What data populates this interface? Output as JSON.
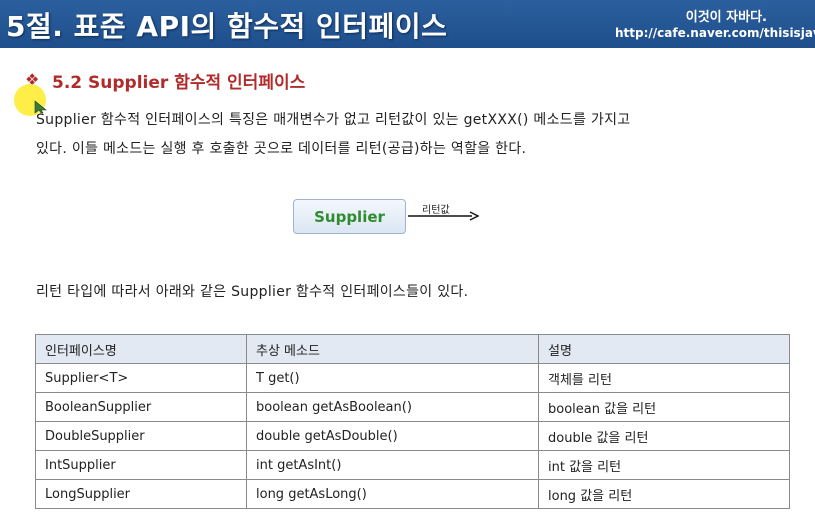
{
  "header": {
    "title": "5절. 표준 API의 함수적 인터페이스",
    "brand": "이것이 자바다.",
    "url": "http://cafe.naver.com/thisisjava"
  },
  "section": {
    "bullet": "❖",
    "heading": "5.2 Supplier 함수적 인터페이스",
    "para1": "Supplier 함수적 인터페이스의 특징은 매개변수가 없고 리턴값이 있는 getXXX() 메소드를 가지고",
    "para2": "있다. 이들 메소드는 실행 후 호출한 곳으로 데이터를 리턴(공급)하는 역할을 한다.",
    "para3": "리턴 타입에 따라서 아래와 같은 Supplier 함수적 인터페이스들이 있다."
  },
  "diagram": {
    "box_label": "Supplier",
    "arrow_label": "리턴값"
  },
  "table": {
    "headers": [
      "인터페이스명",
      "추상 메소드",
      "설명"
    ],
    "rows": [
      [
        "Supplier<T>",
        "T get()",
        "객체를 리턴"
      ],
      [
        "BooleanSupplier",
        "boolean getAsBoolean()",
        "boolean 값을 리턴"
      ],
      [
        "DoubleSupplier",
        "double getAsDouble()",
        "double 값을 리턴"
      ],
      [
        "IntSupplier",
        "int getAsInt()",
        "int 값을 리턴"
      ],
      [
        "LongSupplier",
        "long getAsLong()",
        "long 값을 리턴"
      ]
    ]
  },
  "colors": {
    "header_bg": "#1e4f8c",
    "heading": "#b02c2c",
    "supplier_text": "#2e8b2e",
    "table_header_bg": "#e3e9f2"
  }
}
